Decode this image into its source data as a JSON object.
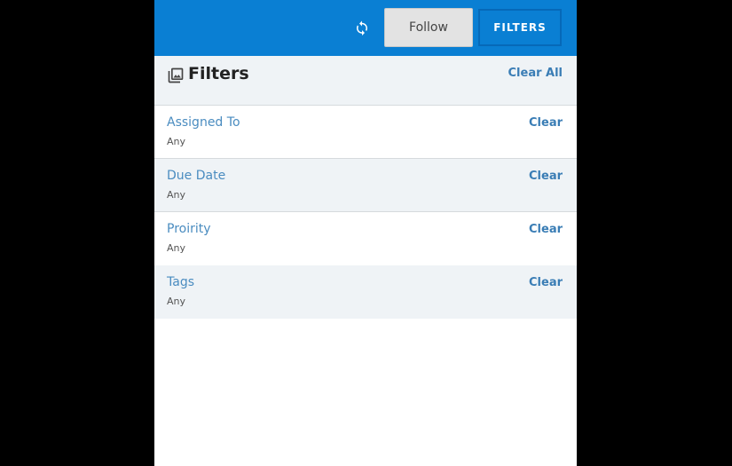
{
  "toolbar": {
    "refresh_icon": "refresh-icon",
    "follow_label": "Follow",
    "filters_label": "FILTERS"
  },
  "filters_panel": {
    "icon": "images-icon",
    "title": "Filters",
    "clear_all_label": "Clear All",
    "items": [
      {
        "label": "Assigned To",
        "value": "Any",
        "clear_label": "Clear"
      },
      {
        "label": "Due Date",
        "value": "Any",
        "clear_label": "Clear"
      },
      {
        "label": "Proirity",
        "value": "Any",
        "clear_label": "Clear"
      },
      {
        "label": "Tags",
        "value": "Any",
        "clear_label": "Clear"
      }
    ]
  },
  "colors": {
    "topbar": "#0a7fd3",
    "accent": "#3a7db5",
    "row_alt": "#eff3f6"
  }
}
